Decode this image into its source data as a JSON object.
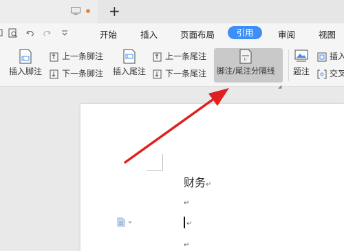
{
  "menu": {
    "items": [
      "开始",
      "插入",
      "页面布局"
    ],
    "active": "引用",
    "items_right": [
      "审阅",
      "视图"
    ]
  },
  "ribbon": {
    "insert_footnote": "插入脚注",
    "prev_footnote": "上一条脚注",
    "next_footnote": "下一条脚注",
    "insert_endnote": "插入尾注",
    "prev_endnote": "上一条尾注",
    "next_endnote": "下一条尾注",
    "separator": "脚注/尾注分隔线",
    "caption": "题注",
    "insert_cut": "插入",
    "cross_ref_cut": "交叉"
  },
  "document": {
    "heading": "财务",
    "para_mark": "↵"
  },
  "colors": {
    "accent": "#3e8ef7",
    "arrow": "#e02020"
  }
}
